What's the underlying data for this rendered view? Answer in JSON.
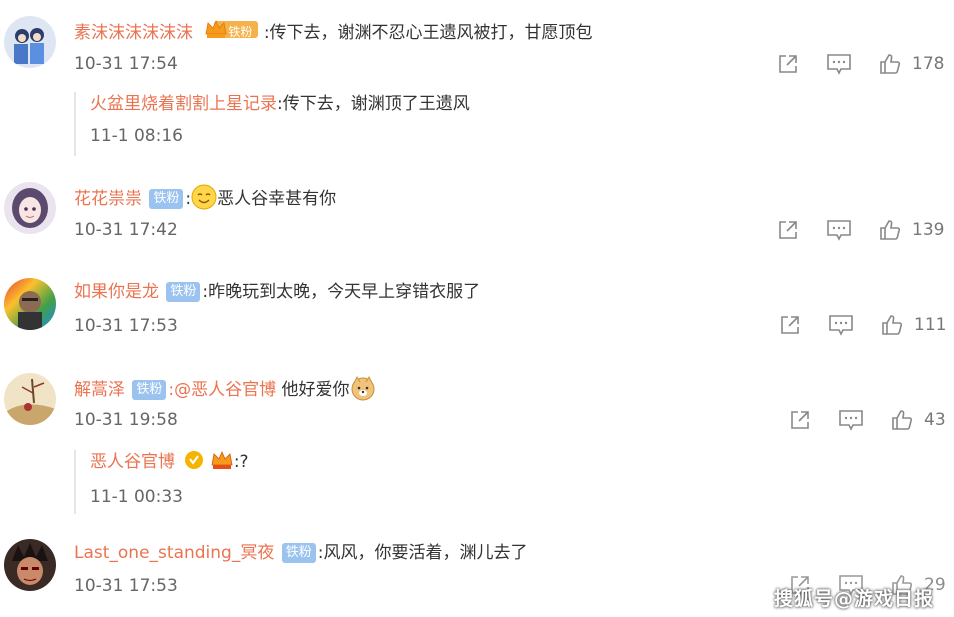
{
  "comments": [
    {
      "user": "素沫沫沫沫沫沫",
      "badge": "铁粉",
      "badge_type": "crown-badge",
      "text": ":传下去，谢渊不忍心王遗风被打，甘愿顶包",
      "time": "10-31 17:54",
      "likes": "178",
      "reply": {
        "user": "火盆里烧着割割上星记录",
        "text": ":传下去，谢渊顶了王遗风",
        "time": "11-1 08:16"
      }
    },
    {
      "user": "花花祟祟",
      "badge": "铁粉",
      "sep": ":",
      "emoji": "smile-emoji",
      "text": "恶人谷幸甚有你",
      "time": "10-31 17:42",
      "likes": "139"
    },
    {
      "user": "如果你是龙",
      "badge": "铁粉",
      "text": ":昨晚玩到太晚，今天早上穿错衣服了",
      "time": "10-31 17:53",
      "likes": "111"
    },
    {
      "user": "解蒿泽",
      "badge": "铁粉",
      "mention": ":@恶人谷官博",
      "text": " 他好爱你",
      "emoji": "doge-emoji",
      "time": "10-31 19:58",
      "likes": "43",
      "reply": {
        "user": "恶人谷官博",
        "text": ":?",
        "time": "11-1 00:33"
      }
    },
    {
      "user": "Last_one_standing_冥夜",
      "badge": "铁粉",
      "text": ":风风，你要活着，渊儿去了",
      "time": "10-31 17:53",
      "likes": "29"
    }
  ],
  "watermark": "搜狐号@游戏日报",
  "colors": {
    "username": "#eb7350",
    "badge": "#9bc3ef",
    "text": "#333333",
    "meta": "#666666"
  }
}
